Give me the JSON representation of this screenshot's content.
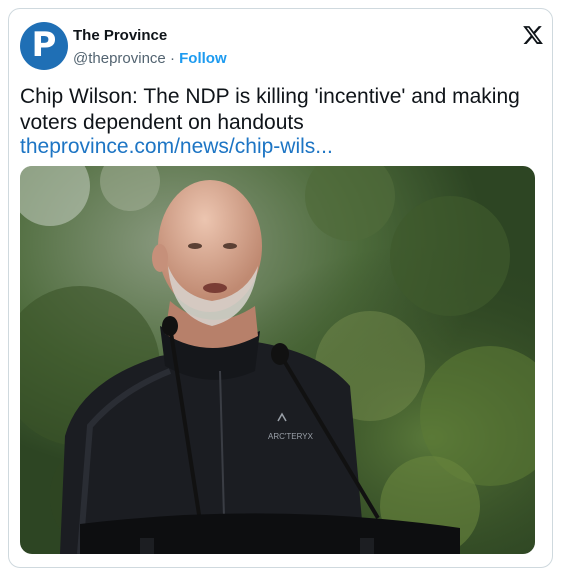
{
  "account": {
    "name": "The Province",
    "handle": "@theprovince",
    "separator": "·",
    "follow_label": "Follow",
    "avatar_letter": "P",
    "avatar_color": "#1f6fb5"
  },
  "tweet": {
    "text": "Chip Wilson: The NDP is killing 'incentive' and making voters dependent on handouts",
    "link": "theprovince.com/news/chip-wils..."
  },
  "photo": {
    "jacket_logo_text": "ARC'TERYX"
  },
  "icons": {
    "x_logo": "x-logo-icon"
  },
  "colors": {
    "link": "#1d75c4",
    "follow": "#1d9bf0",
    "muted": "#536471"
  }
}
